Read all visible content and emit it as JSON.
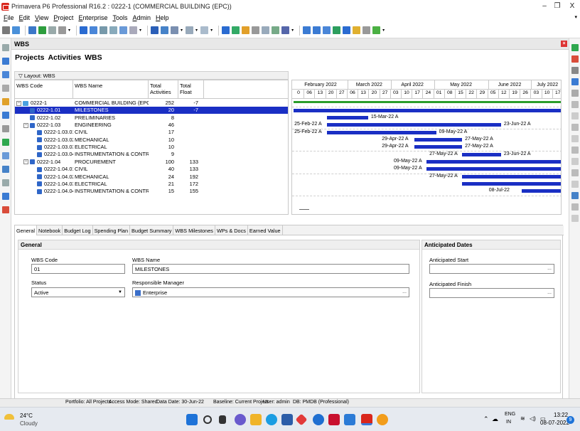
{
  "window": {
    "title": "Primavera P6 Professional R16.2 : 0222-1 (COMMERCIAL BUILDING (EPC))",
    "minimize": "–",
    "restore": "❐",
    "close": "X"
  },
  "menu": [
    {
      "key": "F",
      "rest": "ile"
    },
    {
      "key": "E",
      "rest": "dit"
    },
    {
      "key": "V",
      "rest": "iew"
    },
    {
      "key": "P",
      "rest": "roject"
    },
    {
      "key": "E",
      "rest": "nterprise"
    },
    {
      "key": "T",
      "rest": "ools"
    },
    {
      "key": "A",
      "rest": "dmin"
    },
    {
      "key": "H",
      "rest": "elp"
    }
  ],
  "panel_title": "WBS",
  "page_tabs": [
    "Projects",
    "Activities",
    "WBS"
  ],
  "layout_label": "Layout: WBS",
  "grid": {
    "columns": [
      "WBS Code",
      "WBS Name",
      "Total Activities",
      "Total Float"
    ],
    "rows": [
      {
        "code": "0222-1",
        "name": "COMMERCIAL BUILDING (EPC)",
        "acts": "252",
        "float": "-7",
        "level": 0,
        "exp": "−",
        "icon": "fold"
      },
      {
        "code": "0222-1.01",
        "name": "MILESTONES",
        "acts": "20",
        "float": "-7",
        "level": 1,
        "exp": "",
        "icon": "wbs",
        "sel": true
      },
      {
        "code": "0222-1.02",
        "name": "PRELIMINARIES",
        "acts": "8",
        "float": "",
        "level": 1,
        "exp": "",
        "icon": "wbs"
      },
      {
        "code": "0222-1.03",
        "name": "ENGINEERING",
        "acts": "46",
        "float": "",
        "level": 1,
        "exp": "−",
        "icon": "wbs"
      },
      {
        "code": "0222-1.03.01",
        "name": "CIVIL",
        "acts": "17",
        "float": "",
        "level": 2,
        "exp": "",
        "icon": "wbs"
      },
      {
        "code": "0222-1.03.02",
        "name": "MECHANICAL",
        "acts": "10",
        "float": "",
        "level": 2,
        "exp": "",
        "icon": "wbs"
      },
      {
        "code": "0222-1.03.03",
        "name": "ELECTRICAL",
        "acts": "10",
        "float": "",
        "level": 2,
        "exp": "",
        "icon": "wbs"
      },
      {
        "code": "0222-1.03.04",
        "name": "INSTRUMENTATION & CONTROL",
        "acts": "9",
        "float": "",
        "level": 2,
        "exp": "",
        "icon": "wbs"
      },
      {
        "code": "0222-1.04",
        "name": "PROCUREMENT",
        "acts": "100",
        "float": "133",
        "level": 1,
        "exp": "−",
        "icon": "wbs"
      },
      {
        "code": "0222-1.04.01",
        "name": "CIVIL",
        "acts": "40",
        "float": "133",
        "level": 2,
        "exp": "",
        "icon": "wbs"
      },
      {
        "code": "0222-1.04.02",
        "name": "MECHANICAL",
        "acts": "24",
        "float": "192",
        "level": 2,
        "exp": "",
        "icon": "wbs"
      },
      {
        "code": "0222-1.04.03",
        "name": "ELECTRICAL",
        "acts": "21",
        "float": "172",
        "level": 2,
        "exp": "",
        "icon": "wbs"
      },
      {
        "code": "0222-1.04.04",
        "name": "INSTRUMENTATION & CONTROL",
        "acts": "15",
        "float": "155",
        "level": 2,
        "exp": "",
        "icon": "wbs"
      }
    ]
  },
  "gantt": {
    "months": [
      "February 2022",
      "March 2022",
      "April 2022",
      "May 2022",
      "June 2022",
      "July 2022"
    ],
    "weeks": [
      "0",
      "06",
      "13",
      "20",
      "27",
      "06",
      "13",
      "20",
      "27",
      "03",
      "10",
      "17",
      "24",
      "01",
      "08",
      "15",
      "22",
      "29",
      "05",
      "12",
      "19",
      "26",
      "03",
      "10",
      "17"
    ],
    "bars": [
      {
        "row": 0,
        "start": 0,
        "end": 25,
        "label": "",
        "side": "none",
        "green": true
      },
      {
        "row": 1,
        "start": 0,
        "end": 25,
        "label": "",
        "side": "none"
      },
      {
        "row": 2,
        "start": 3.1,
        "end": 6.9,
        "label": "15-Mar-22 A",
        "side": "right"
      },
      {
        "row": 3,
        "start": 3.1,
        "end": 19.2,
        "label": "25-Feb-22 A",
        "side": "left",
        "rlabel": "23-Jun-22 A"
      },
      {
        "row": 4,
        "start": 3.1,
        "end": 13.2,
        "label": "25-Feb-22 A",
        "side": "left",
        "rlabel": "09-May-22 A"
      },
      {
        "row": 5,
        "start": 11.2,
        "end": 15.6,
        "label": "29-Apr-22 A",
        "side": "left",
        "rlabel": "27-May-22 A"
      },
      {
        "row": 6,
        "start": 11.2,
        "end": 15.6,
        "label": "29-Apr-22 A",
        "side": "left",
        "rlabel": "27-May-22 A"
      },
      {
        "row": 7,
        "start": 15.6,
        "end": 19.2,
        "label": "27-May-22 A",
        "side": "left",
        "rlabel": "23-Jun-22 A"
      },
      {
        "row": 8,
        "start": 12.3,
        "end": 25,
        "label": "09-May-22 A",
        "side": "left"
      },
      {
        "row": 9,
        "start": 12.3,
        "end": 25,
        "label": "09-May-22 A",
        "side": "left"
      },
      {
        "row": 10,
        "start": 15.6,
        "end": 25,
        "label": "27-May-22 A",
        "side": "left"
      },
      {
        "row": 11,
        "start": 15.6,
        "end": 25,
        "label": "",
        "side": "none"
      },
      {
        "row": 12,
        "start": 21.1,
        "end": 25,
        "label": "08-Jul-22",
        "side": "left"
      }
    ]
  },
  "bottom_tabs": [
    "General",
    "Notebook",
    "Budget Log",
    "Spending Plan",
    "Budget Summary",
    "WBS Milestones",
    "WPs & Docs",
    "Earned Value"
  ],
  "general": {
    "title": "General",
    "wbs_code_label": "WBS Code",
    "wbs_code": "01",
    "wbs_name_label": "WBS Name",
    "wbs_name": "MILESTONES",
    "status_label": "Status",
    "status": "Active",
    "rm_label": "Responsible Manager",
    "rm": "Enterprise"
  },
  "anticipated": {
    "title": "Anticipated Dates",
    "start_label": "Anticipated Start",
    "finish_label": "Anticipated Finish"
  },
  "status_bar": {
    "portfolio": "Portfolio: All Projects",
    "access": "Access Mode: Shared",
    "data_date": "Data Date: 30-Jun-22",
    "baseline": "Baseline: Current Project",
    "user": "User: admin",
    "db": "DB: PMDB (Professional)"
  },
  "taskbar": {
    "temp": "24°C",
    "weather": "Cloudy",
    "lang1": "ENG",
    "lang2": "IN",
    "time": "13:22",
    "date": "08-07-2022",
    "notif": "9"
  },
  "colors": {
    "bar": "#1a2fc4",
    "selection": "#1a2fc4",
    "green": "#2a9d2a"
  }
}
